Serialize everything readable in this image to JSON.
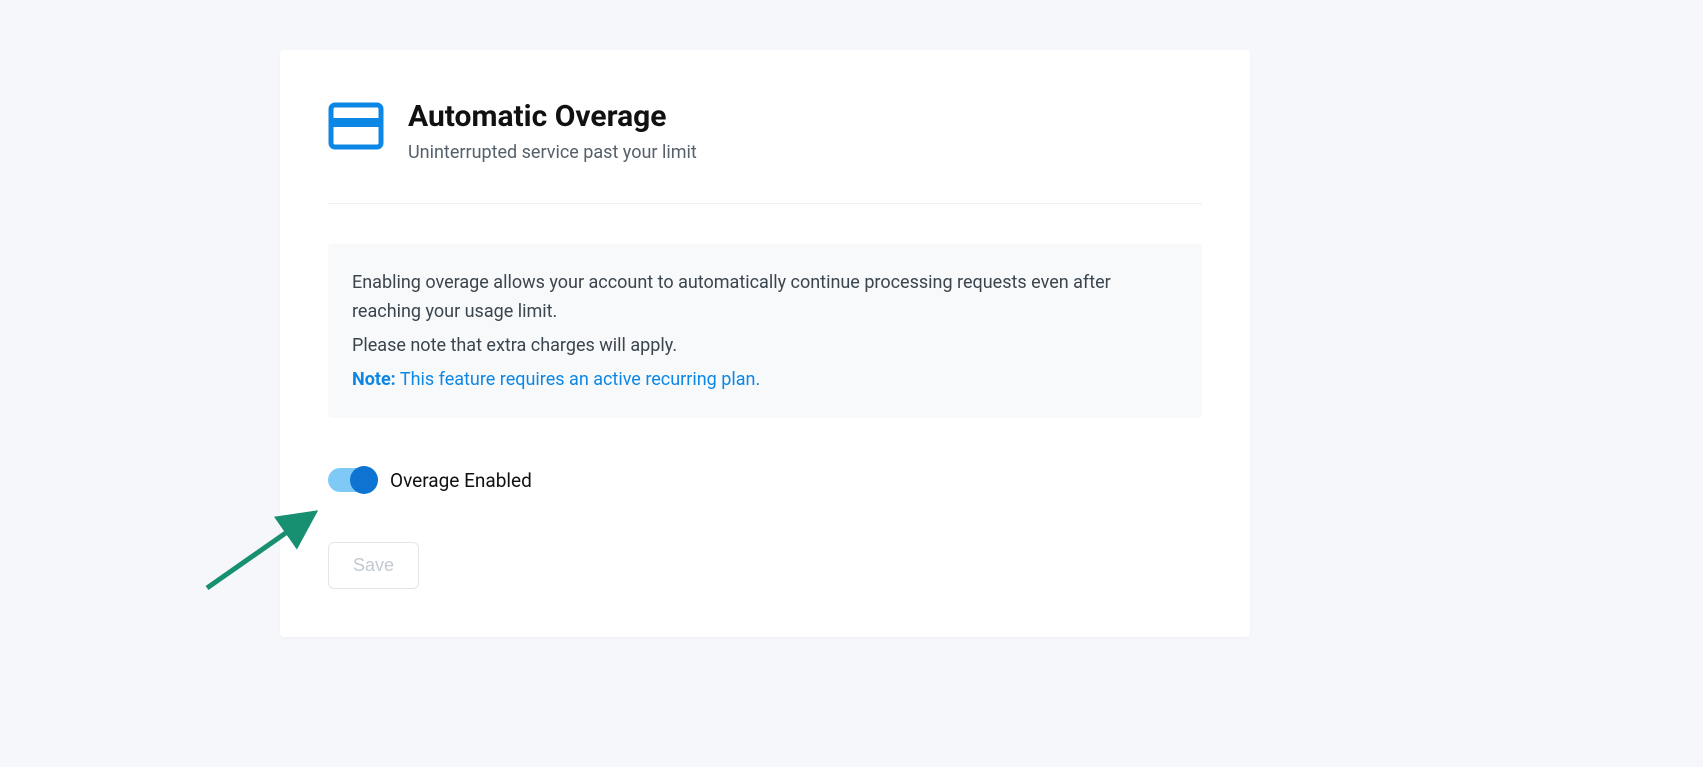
{
  "header": {
    "title": "Automatic Overage",
    "subtitle": "Uninterrupted service past your limit"
  },
  "info": {
    "line1": "Enabling overage allows your account to automatically continue processing requests even after reaching your usage limit.",
    "line2": "Please note that extra charges will apply.",
    "note_label": "Note:",
    "note_text": " This feature requires an active recurring plan."
  },
  "toggle": {
    "label": "Overage Enabled",
    "enabled": true
  },
  "actions": {
    "save_label": "Save"
  },
  "colors": {
    "primary_blue": "#0d87e6",
    "toggle_track": "#7fc9f7",
    "toggle_knob": "#0d74d1",
    "arrow": "#178f71"
  }
}
